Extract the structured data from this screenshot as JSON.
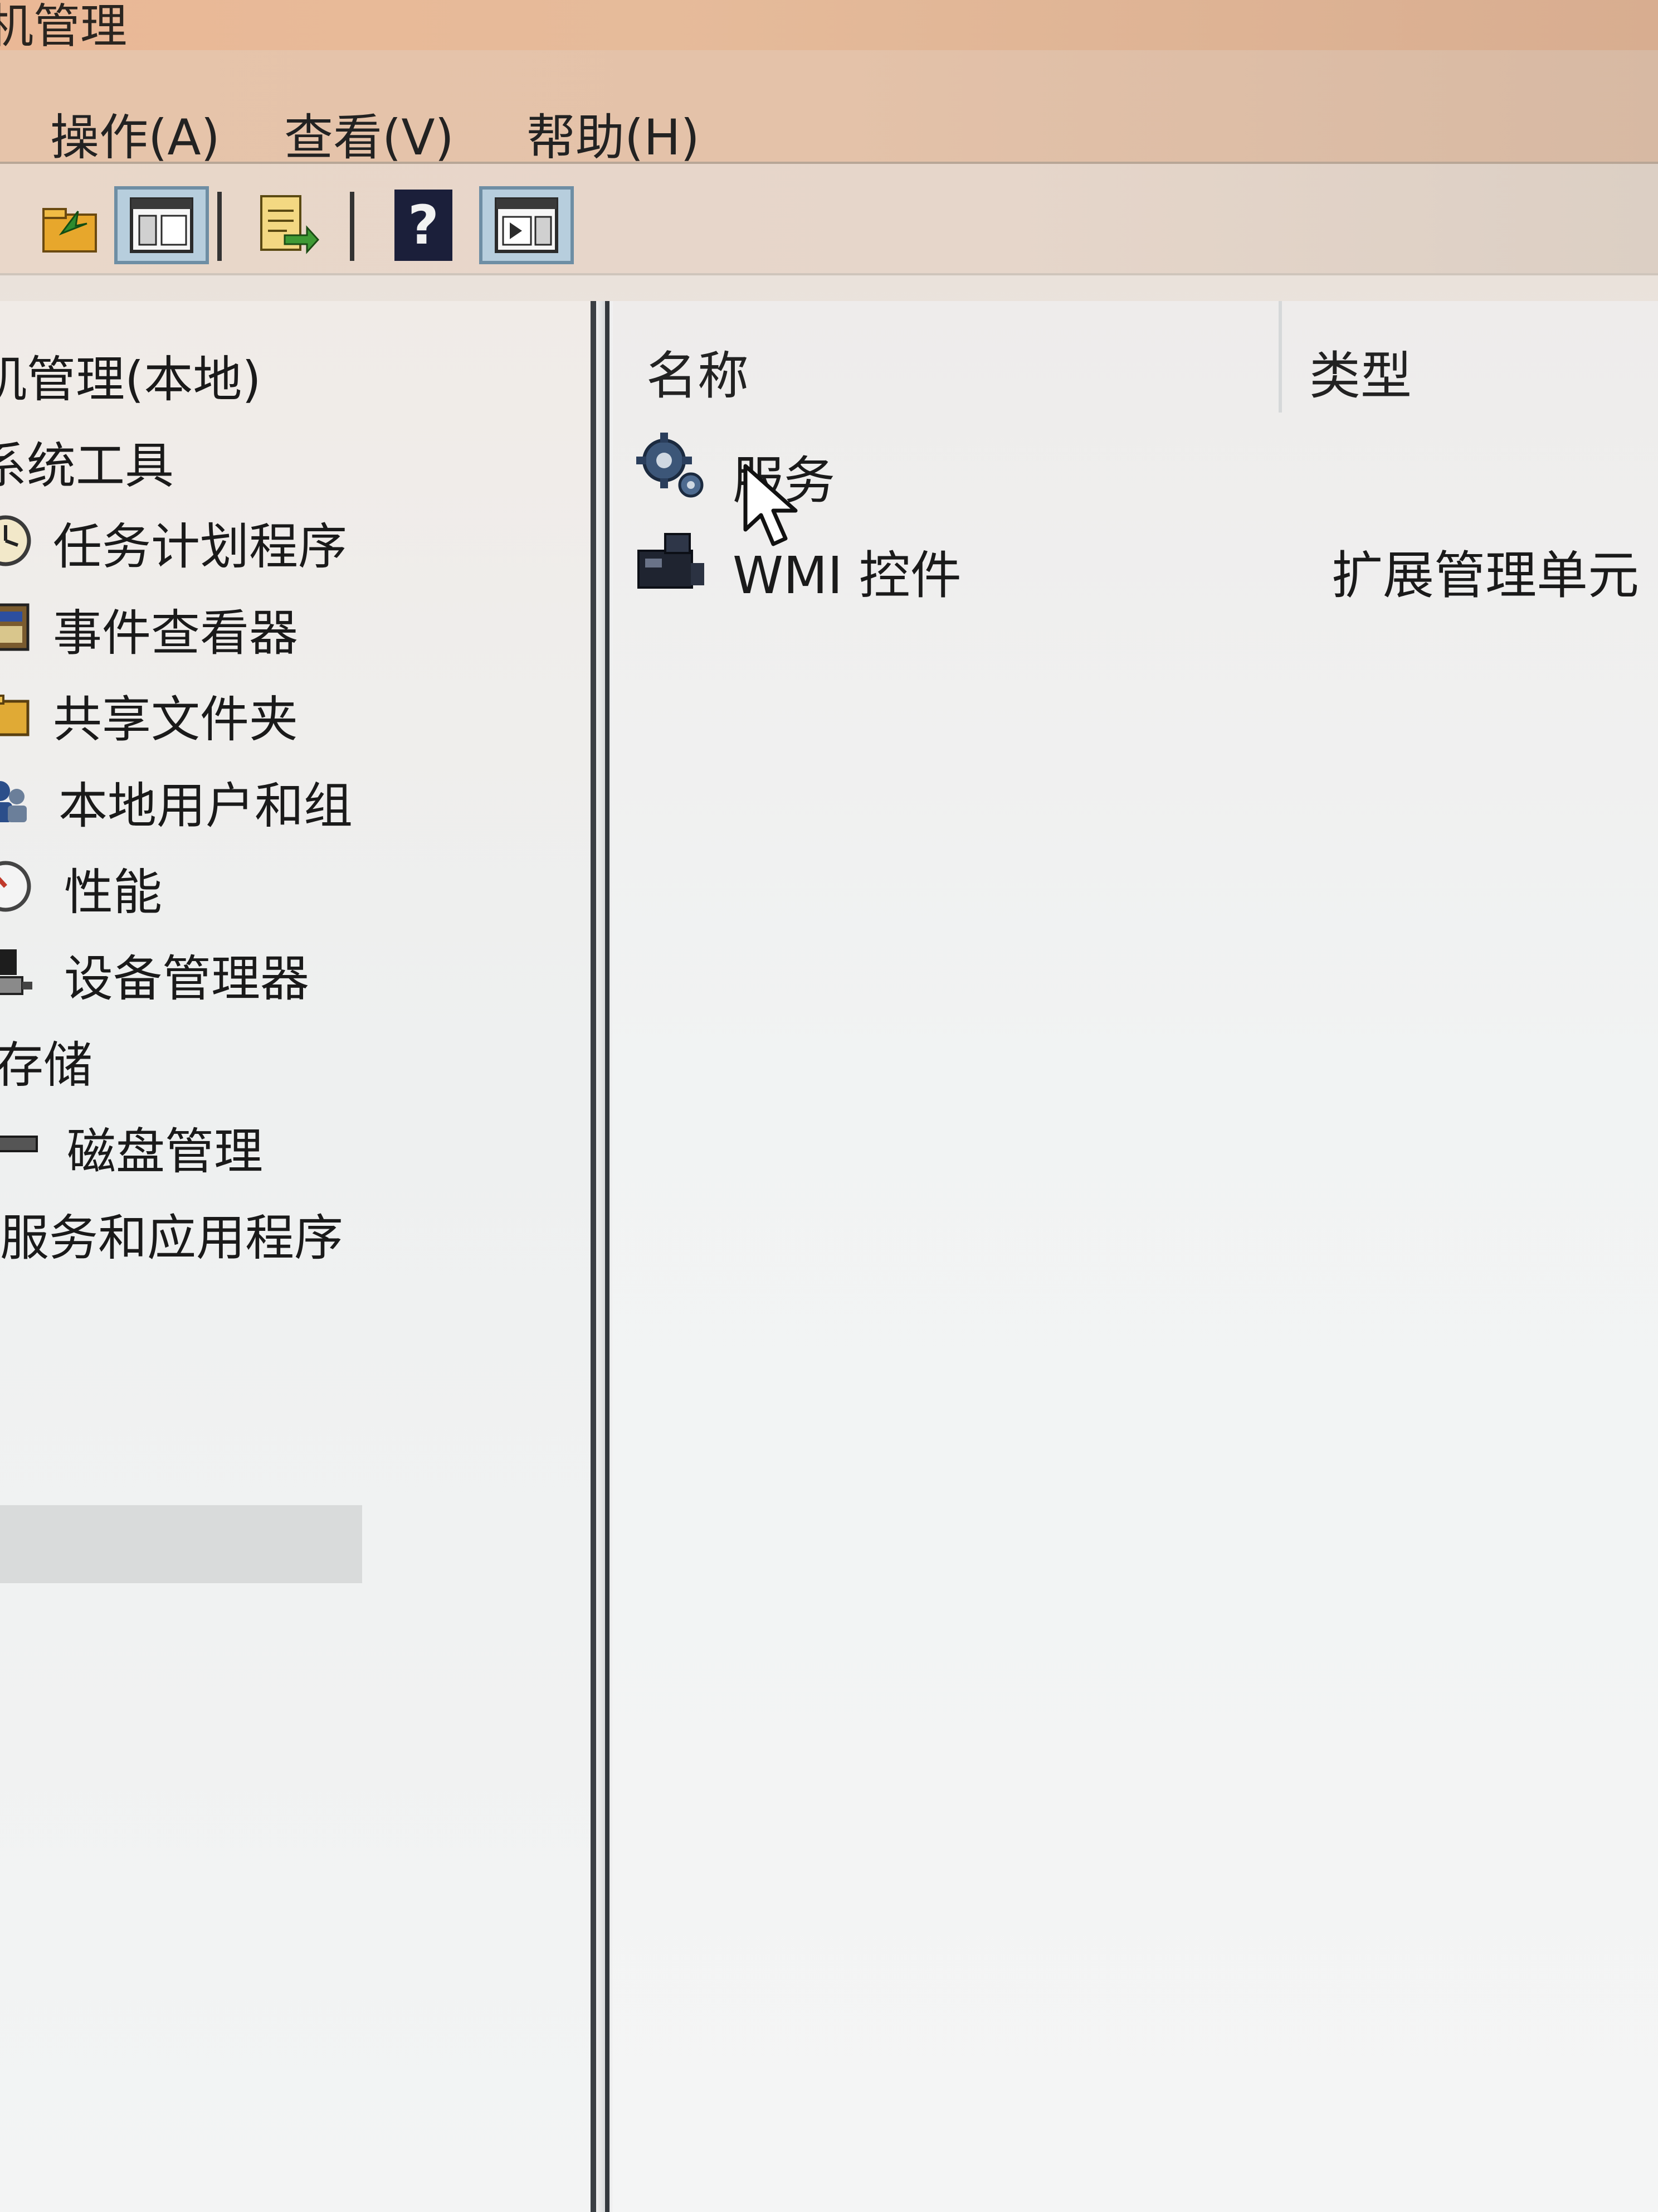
{
  "window": {
    "title": "机管理"
  },
  "menu": [
    {
      "label": "操作(A)"
    },
    {
      "label": "查看(V)"
    },
    {
      "label": "帮助(H)"
    }
  ],
  "toolbar": {
    "buttons": [
      {
        "icon": "folder-up-icon",
        "active": false
      },
      {
        "icon": "console-view-icon",
        "active": true
      },
      {
        "icon": "export-list-icon",
        "active": false
      },
      {
        "icon": "help-icon",
        "active": false
      },
      {
        "icon": "action-pane-icon",
        "active": true
      }
    ],
    "help_glyph": "?"
  },
  "tree": {
    "root": "机管理(本地)",
    "items": [
      {
        "label": "系统工具",
        "icon": null
      },
      {
        "label": "任务计划程序",
        "icon": "clock-icon"
      },
      {
        "label": "事件查看器",
        "icon": "event-viewer-icon"
      },
      {
        "label": "共享文件夹",
        "icon": "shared-folder-icon"
      },
      {
        "label": "本地用户和组",
        "icon": "users-icon"
      },
      {
        "label": "性能",
        "icon": "performance-icon"
      },
      {
        "label": "设备管理器",
        "icon": "device-manager-icon"
      },
      {
        "label": "存储",
        "icon": null
      },
      {
        "label": "磁盘管理",
        "icon": "disk-icon"
      },
      {
        "label": "服务和应用程序",
        "icon": null,
        "selected": true
      }
    ]
  },
  "list": {
    "columns": [
      "名称",
      "类型"
    ],
    "rows": [
      {
        "name": "服务",
        "type": "",
        "icon": "gear-icon"
      },
      {
        "name": "WMI 控件",
        "type": "扩展管理单元",
        "icon": "wmi-control-icon"
      }
    ]
  },
  "colors": {
    "selection": "#d9dbdb",
    "active_button": "#b7cedd",
    "pane_border": "#3b3f44"
  }
}
